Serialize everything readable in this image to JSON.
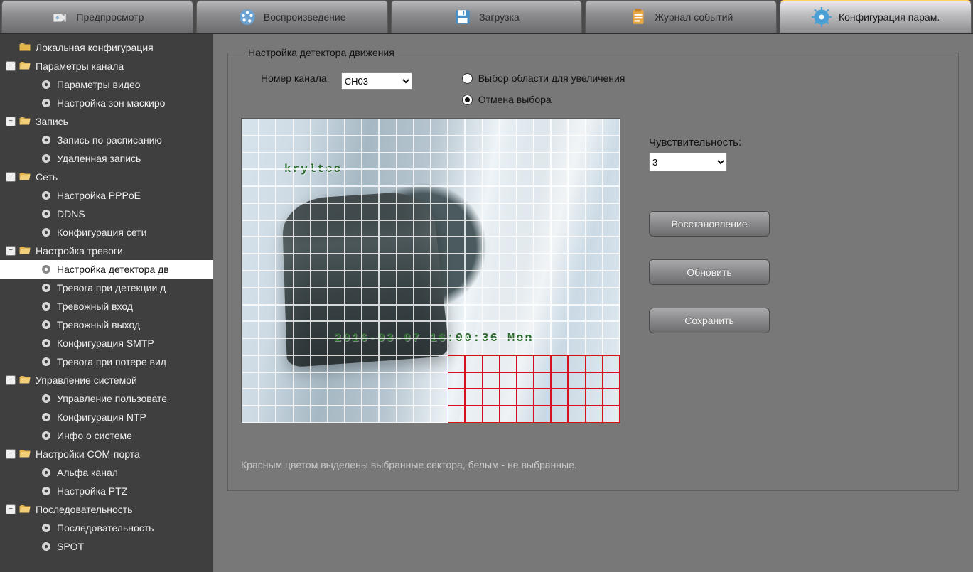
{
  "tabs": {
    "preview": "Предпросмотр",
    "playback": "Воспроизведение",
    "download": "Загрузка",
    "events": "Журнал событий",
    "config": "Конфигурация парам."
  },
  "sidebar": {
    "local_config": "Локальная конфигурация",
    "channel_params": "Параметры канала",
    "video_params": "Параметры видео",
    "mask_zones": "Настройка зон маскиро",
    "record": "Запись",
    "record_schedule": "Запись по расписанию",
    "remote_record": "Удаленная запись",
    "network": "Сеть",
    "pppoe": "Настройка PPPoE",
    "ddns": "DDNS",
    "net_config": "Конфигурация сети",
    "alarm": "Настройка тревоги",
    "motion_detector": "Настройка детектора дв",
    "detect_alarm": "Тревога при детекции д",
    "alarm_in": "Тревожный вход",
    "alarm_out": "Тревожный выход",
    "smtp": "Конфигурация SMTP",
    "video_loss": "Тревога при потере вид",
    "system": "Управление системой",
    "users": "Управление пользовате",
    "ntp": "Конфигурация NTP",
    "sysinfo": "Инфо о системе",
    "com": "Настройки COM-порта",
    "alpha": "Альфа канал",
    "ptz": "Настройка PTZ",
    "sequence": "Последовательность",
    "sequence2": "Последовательность",
    "spot": "SPOT"
  },
  "panel": {
    "legend": "Настройка детектора движения",
    "channel_label": "Номер канала",
    "channel_value": "CH03",
    "radio_zoom": "Выбор области для увеличения",
    "radio_cancel": "Отмена выбора",
    "sensitivity_label": "Чувствительность:",
    "sensitivity_value": "3",
    "btn_restore": "Восстановление",
    "btn_refresh": "Обновить",
    "btn_save": "Сохранить",
    "hint": "Красным цветом выделены выбранные сектора, белым - не выбранные."
  },
  "osd": {
    "camera": "kryltco",
    "time": "2016-03-07 16:00:36 Mon"
  }
}
